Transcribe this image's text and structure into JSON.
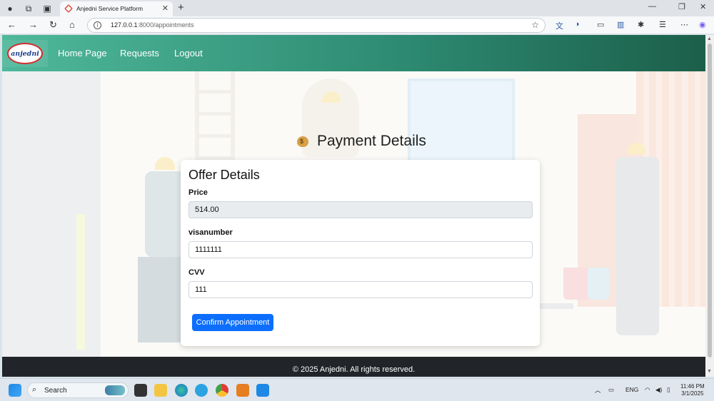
{
  "browser": {
    "tab_title": "Anjedni Service Platform",
    "url_host": "127.0.0.1",
    "url_path": ":8000/appointments",
    "info_icon": "i"
  },
  "navbar": {
    "logo_text": "anjedni",
    "links": [
      "Home Page",
      "Requests",
      "Logout"
    ]
  },
  "page": {
    "heading": "Payment Details"
  },
  "card": {
    "title": "Offer Details",
    "fields": [
      {
        "label": "Price",
        "value": "514.00",
        "readonly": true
      },
      {
        "label": "visanumber",
        "value": "1111111",
        "readonly": false
      },
      {
        "label": "CVV",
        "value": "111",
        "readonly": false
      }
    ],
    "submit_label": "Confirm Appointment"
  },
  "footer": {
    "text": "© 2025 Anjedni. All rights reserved."
  },
  "taskbar": {
    "search_placeholder": "Search",
    "language": "ENG",
    "time": "11:46 PM",
    "date": "3/1/2025"
  },
  "colors": {
    "navbar_start": "#4fb89a",
    "navbar_end": "#1c5f4a",
    "button": "#0d6efd",
    "footer": "#212529"
  },
  "icons": [
    "back-icon",
    "forward-icon",
    "reload-icon",
    "home-icon",
    "star-icon",
    "money-bag-icon",
    "windows-start-icon"
  ]
}
